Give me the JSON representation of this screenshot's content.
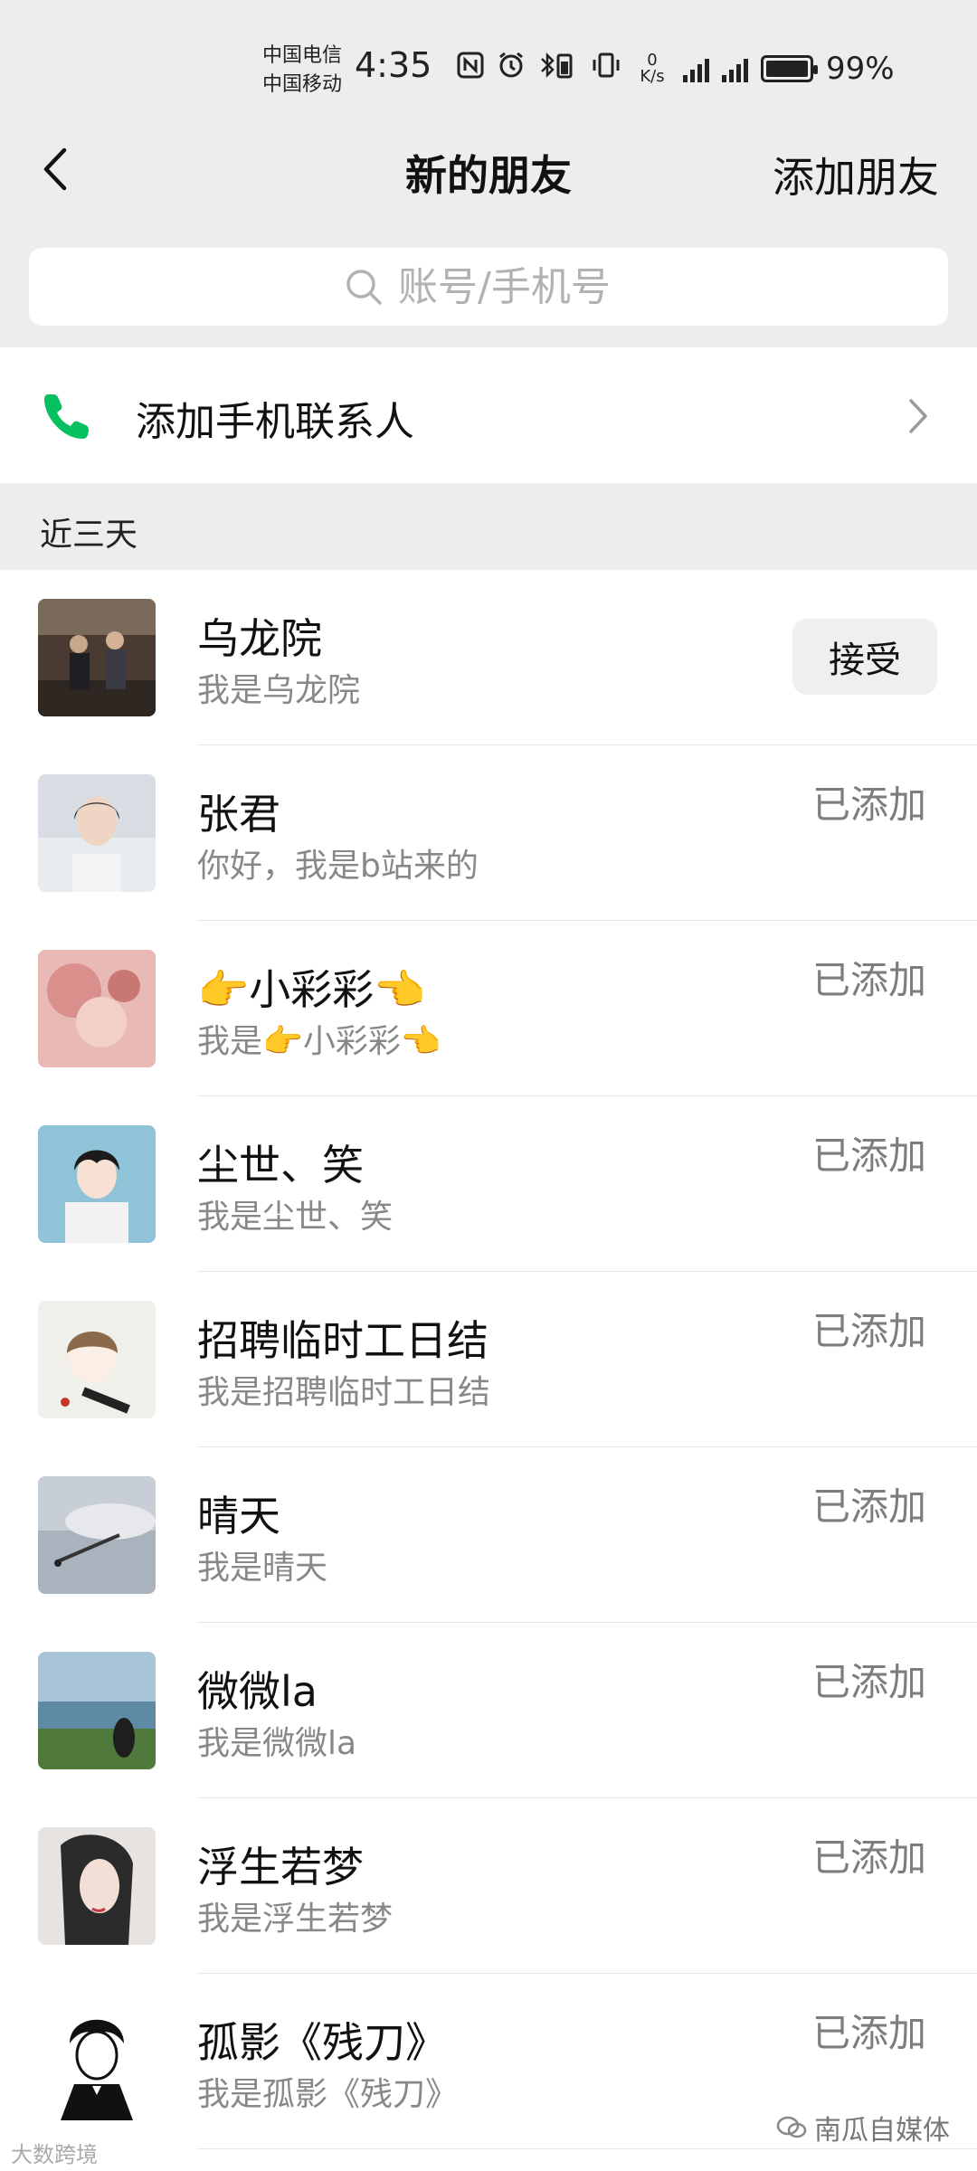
{
  "status_bar": {
    "carrier_1": "中国电信",
    "carrier_2": "中国移动",
    "time": "4:35",
    "net_speed_value": "0",
    "net_speed_unit": "K/s",
    "battery": "99%"
  },
  "nav": {
    "title": "新的朋友",
    "add_friend": "添加朋友"
  },
  "search": {
    "placeholder": "账号/手机号"
  },
  "phone_contacts": {
    "label": "添加手机联系人"
  },
  "section": {
    "title": "近三天"
  },
  "requests": [
    {
      "name": "乌龙院",
      "message": "我是乌龙院",
      "action": "接受"
    },
    {
      "name": "张君",
      "message": "你好，我是b站来的",
      "status": "已添加"
    },
    {
      "name": "👉小彩彩👈",
      "message": "我是👉小彩彩👈",
      "status": "已添加"
    },
    {
      "name": "尘世、笑",
      "message": "我是尘世、笑",
      "status": "已添加"
    },
    {
      "name": "招聘临时工日结",
      "message": "我是招聘临时工日结",
      "status": "已添加"
    },
    {
      "name": "晴天",
      "message": "我是晴天",
      "status": "已添加"
    },
    {
      "name": "微微la",
      "message": "我是微微la",
      "status": "已添加"
    },
    {
      "name": "浮生若梦",
      "message": "我是浮生若梦",
      "status": "已添加"
    },
    {
      "name": "孤影《残刀》",
      "message": "我是孤影《残刀》",
      "status": "已添加"
    }
  ],
  "watermarks": {
    "right": "南瓜自媒体",
    "left": "大数跨境"
  },
  "colors": {
    "header_bg": "#ededed",
    "phone_icon": "#07c160",
    "secondary_text": "#888888"
  }
}
